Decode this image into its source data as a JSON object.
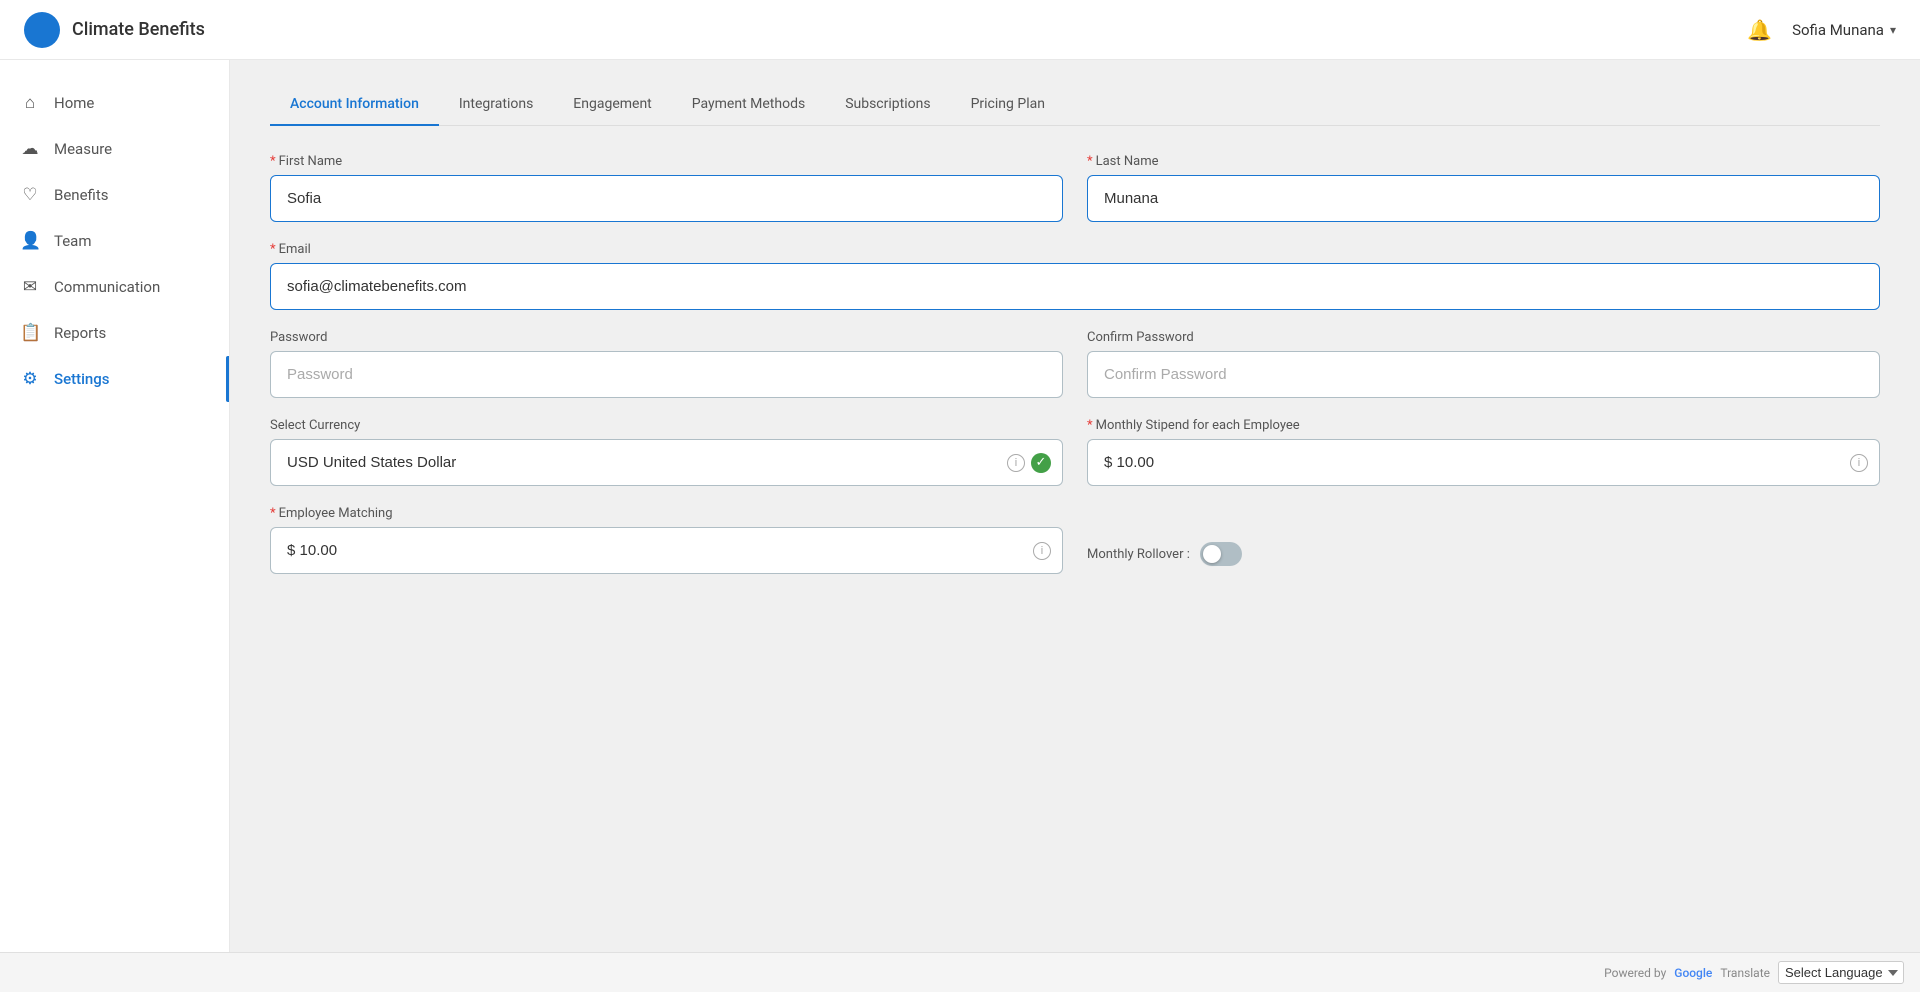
{
  "header": {
    "app_name": "Climate Benefits",
    "bell_label": "notifications",
    "user_name": "Sofia Munana",
    "chevron": "▾"
  },
  "sidebar": {
    "items": [
      {
        "id": "home",
        "label": "Home",
        "icon": "⌂",
        "active": false
      },
      {
        "id": "measure",
        "label": "Measure",
        "icon": "☁",
        "active": false
      },
      {
        "id": "benefits",
        "label": "Benefits",
        "icon": "♡",
        "active": false
      },
      {
        "id": "team",
        "label": "Team",
        "icon": "👤",
        "active": false
      },
      {
        "id": "communication",
        "label": "Communication",
        "icon": "✉",
        "active": false
      },
      {
        "id": "reports",
        "label": "Reports",
        "icon": "📋",
        "active": false
      },
      {
        "id": "settings",
        "label": "Settings",
        "icon": "⚙",
        "active": true
      }
    ]
  },
  "tabs": [
    {
      "id": "account-information",
      "label": "Account Information",
      "active": true
    },
    {
      "id": "integrations",
      "label": "Integrations",
      "active": false
    },
    {
      "id": "engagement",
      "label": "Engagement",
      "active": false
    },
    {
      "id": "payment-methods",
      "label": "Payment Methods",
      "active": false
    },
    {
      "id": "subscriptions",
      "label": "Subscriptions",
      "active": false
    },
    {
      "id": "pricing-plan",
      "label": "Pricing Plan",
      "active": false
    }
  ],
  "form": {
    "first_name_label": "First Name",
    "first_name_value": "Sofia",
    "last_name_label": "Last Name",
    "last_name_value": "Munana",
    "email_label": "Email",
    "email_value": "sofia@climatebenefits.com",
    "password_label": "Password",
    "password_placeholder": "Password",
    "confirm_password_label": "Confirm Password",
    "confirm_password_placeholder": "Confirm Password",
    "currency_label": "Select Currency",
    "currency_value": "USD United States Dollar",
    "stipend_label": "Monthly Stipend for each Employee",
    "stipend_value": "$ 10.00",
    "employee_matching_label": "Employee Matching",
    "employee_matching_value": "$ 10.00",
    "monthly_rollover_label": "Monthly Rollover :",
    "required_star": "*"
  },
  "footer": {
    "powered_by": "Powered by",
    "google": "Google",
    "translate": "Translate",
    "select_language": "Select Language"
  }
}
